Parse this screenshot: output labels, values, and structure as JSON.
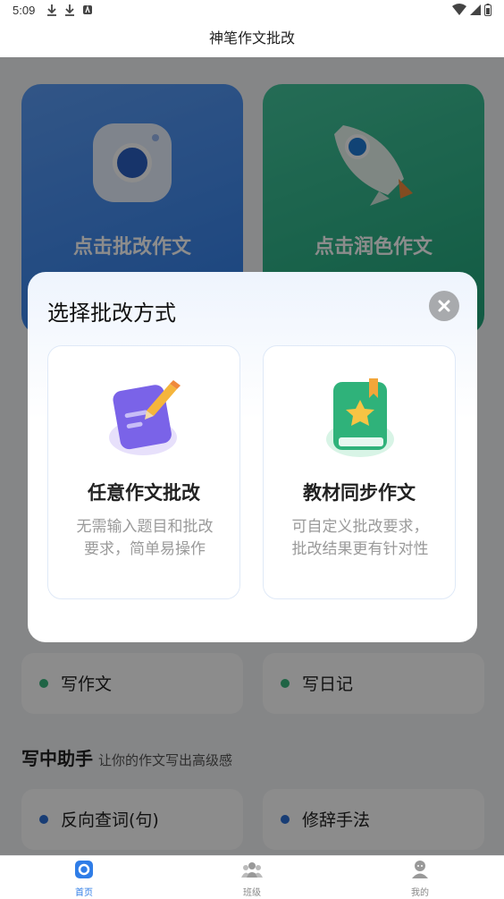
{
  "status_bar": {
    "time": "5:09"
  },
  "header": {
    "title": "神笔作文批改"
  },
  "hero": {
    "left_label": "点击批改作文",
    "right_label": "点击润色作文"
  },
  "section_practice": {
    "items": [
      {
        "label": "写作文",
        "bullet_color": "#3ab77f"
      },
      {
        "label": "写日记",
        "bullet_color": "#3ab77f"
      }
    ]
  },
  "section_helper": {
    "title": "写中助手",
    "subtitle": "让你的作文写出高级感",
    "items": [
      {
        "label": "反向查词(句)",
        "bullet_color": "#2c6fd6"
      },
      {
        "label": "修辞手法",
        "bullet_color": "#2c6fd6"
      }
    ]
  },
  "dialog": {
    "title": "选择批改方式",
    "options": [
      {
        "title": "任意作文批改",
        "desc_line1": "无需输入题目和批改",
        "desc_line2": "要求，简单易操作",
        "icon": "notebook-pencil-icon"
      },
      {
        "title": "教材同步作文",
        "desc_line1": "可自定义批改要求，",
        "desc_line2": "批改结果更有针对性",
        "icon": "green-book-star-icon"
      }
    ]
  },
  "bottom_nav": {
    "items": [
      {
        "label": "首页",
        "active": true
      },
      {
        "label": "班级",
        "active": false
      },
      {
        "label": "我的",
        "active": false
      }
    ],
    "active_color": "#2f7de7",
    "inactive_color": "#888888"
  }
}
